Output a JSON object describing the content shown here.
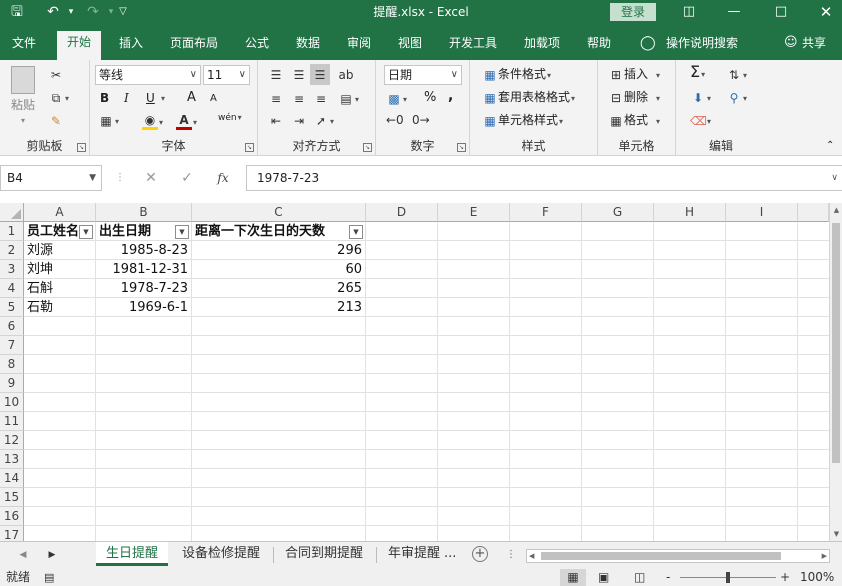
{
  "titlebar": {
    "title": "提醒.xlsx  -  Excel",
    "login": "登录",
    "icons": {
      "save": "save-icon",
      "undo": "undo-icon",
      "redo": "redo-icon",
      "customize": "customize-icon"
    }
  },
  "tabs": [
    {
      "label": "文件"
    },
    {
      "label": "开始"
    },
    {
      "label": "插入"
    },
    {
      "label": "页面布局"
    },
    {
      "label": "公式"
    },
    {
      "label": "数据"
    },
    {
      "label": "审阅"
    },
    {
      "label": "视图"
    },
    {
      "label": "开发工具"
    },
    {
      "label": "加载项"
    },
    {
      "label": "帮助"
    }
  ],
  "tellme": "操作说明搜索",
  "share": "共享",
  "ribbon": {
    "clipboard": {
      "label": "剪贴板",
      "paste": "粘贴"
    },
    "font": {
      "label": "字体",
      "name": "等线",
      "size": "11",
      "bold": "B",
      "italic": "I",
      "underline": "U",
      "grow": "A",
      "shrink": "A",
      "phonetic": "wén"
    },
    "alignment": {
      "label": "对齐方式"
    },
    "number": {
      "label": "数字",
      "format": "日期",
      "percent": "%",
      "comma": ","
    },
    "styles": {
      "label": "样式",
      "conditional": "条件格式",
      "table": "套用表格格式",
      "cell": "单元格样式"
    },
    "cells": {
      "label": "单元格",
      "insert": "插入",
      "delete": "删除",
      "format": "格式"
    },
    "editing": {
      "label": "编辑"
    }
  },
  "formula_bar": {
    "name_box": "B4",
    "fx": "fx",
    "formula": "1978-7-23"
  },
  "columns": [
    "A",
    "B",
    "C",
    "D",
    "E",
    "F",
    "G",
    "H",
    "I"
  ],
  "rows": [
    "1",
    "2",
    "3",
    "4",
    "5",
    "6",
    "7",
    "8",
    "9",
    "10",
    "11",
    "12",
    "13",
    "14",
    "15",
    "16",
    "17"
  ],
  "table": {
    "headers": [
      "员工姓名",
      "出生日期",
      "距离一下次生日的天数"
    ],
    "data": [
      [
        "刘源",
        "1985-8-23",
        "296"
      ],
      [
        "刘坤",
        "1981-12-31",
        "60"
      ],
      [
        "石斛",
        "1978-7-23",
        "265"
      ],
      [
        "石勒",
        "1969-6-1",
        "213"
      ]
    ]
  },
  "sheets": [
    {
      "label": "生日提醒",
      "active": true
    },
    {
      "label": "设备检修提醒"
    },
    {
      "label": "合同到期提醒"
    },
    {
      "label": "年审提醒"
    }
  ],
  "sheets_more": "...",
  "status": {
    "ready": "就绪",
    "zoom": "100%",
    "minus": "-",
    "plus": "+"
  },
  "colors": {
    "accent": "#217346",
    "ribbon_bg": "#f3f3f3",
    "grid_line": "#e1e1e1"
  }
}
